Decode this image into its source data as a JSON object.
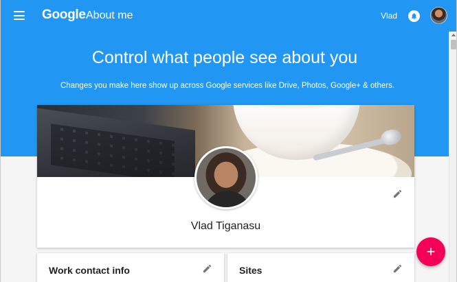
{
  "header": {
    "logo": "Google",
    "product": "About me",
    "user_name": "Vlad",
    "icons": {
      "menu": "menu-icon",
      "notifications": "notifications-icon"
    }
  },
  "hero": {
    "title": "Control what people see about you",
    "subtitle": "Changes you make here show up across Google services like Drive, Photos, Google+ & others."
  },
  "profile": {
    "name": "Vlad Tiganasu"
  },
  "cards": {
    "work_contact": {
      "title": "Work contact info"
    },
    "sites": {
      "title": "Sites"
    }
  },
  "fab": {
    "label": "+"
  },
  "colors": {
    "primary": "#2196f3",
    "accent": "#f50057",
    "text": "#212121",
    "icon": "#757575"
  }
}
